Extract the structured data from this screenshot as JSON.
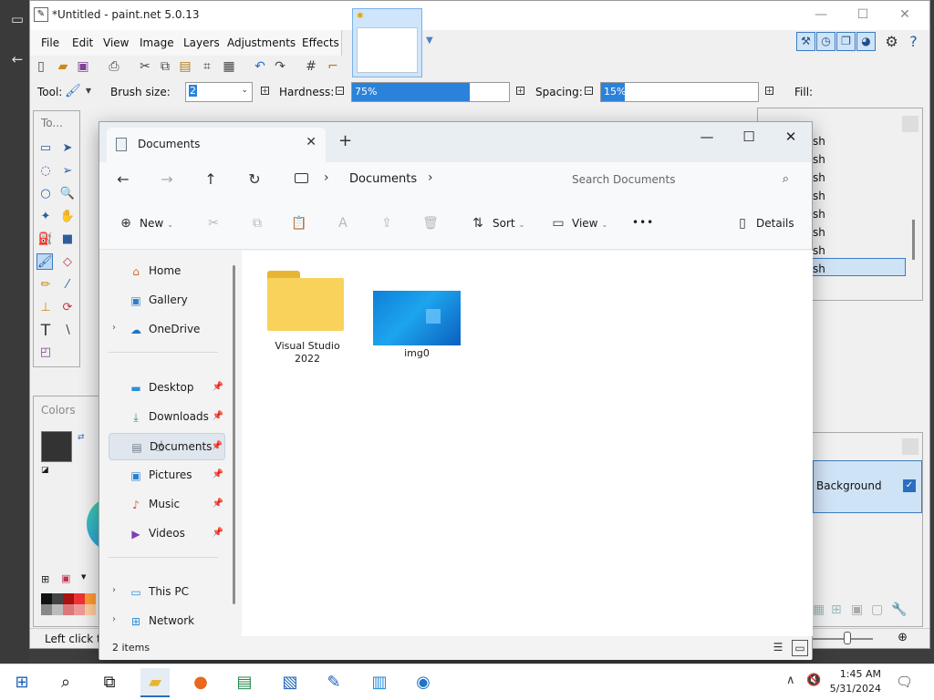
{
  "paintnet": {
    "title": "*Untitled - paint.net 5.0.13",
    "menu": [
      "File",
      "Edit",
      "View",
      "Image",
      "Layers",
      "Adjustments",
      "Effects"
    ],
    "options": {
      "tool_label": "Tool:",
      "brush_size_label": "Brush size:",
      "brush_size_value": "2",
      "hardness_label": "Hardness:",
      "hardness_value": "75%",
      "hardness_percent": 75,
      "spacing_label": "Spacing:",
      "spacing_value": "15%",
      "spacing_percent": 15,
      "fill_label": "Fill:"
    },
    "tools_panel_title": "To...",
    "colors_panel_title": "Colors",
    "history_items": [
      "sh",
      "sh",
      "sh",
      "sh",
      "sh",
      "sh",
      "sh",
      "sh"
    ],
    "layer_name": "Background",
    "status_text": "Left click to"
  },
  "explorer": {
    "tab_title": "Documents",
    "address_location": "Documents",
    "search_placeholder": "Search Documents",
    "commands": {
      "new": "New",
      "sort": "Sort",
      "view": "View",
      "more": "•••",
      "details": "Details"
    },
    "nav_top": [
      {
        "label": "Home",
        "icon": "home-icon"
      },
      {
        "label": "Gallery",
        "icon": "gallery-icon"
      },
      {
        "label": "OneDrive",
        "icon": "cloud-icon"
      }
    ],
    "nav_quick": [
      {
        "label": "Desktop",
        "icon": "desktop-icon"
      },
      {
        "label": "Downloads",
        "icon": "download-icon"
      },
      {
        "label": "Documents",
        "icon": "documents-icon"
      },
      {
        "label": "Pictures",
        "icon": "pictures-icon"
      },
      {
        "label": "Music",
        "icon": "music-icon"
      },
      {
        "label": "Videos",
        "icon": "videos-icon"
      }
    ],
    "nav_bottom": [
      {
        "label": "This PC",
        "icon": "pc-icon"
      },
      {
        "label": "Network",
        "icon": "network-icon"
      }
    ],
    "items": [
      {
        "name_line1": "Visual Studio",
        "name_line2": "2022",
        "type": "folder"
      },
      {
        "name_line1": "img0",
        "name_line2": "",
        "type": "image"
      }
    ],
    "status": "2 items"
  },
  "taskbar": {
    "time": "1:45 AM",
    "date": "5/31/2024"
  },
  "colors": {
    "accent": "#2a82da",
    "folder": "#f9d25c",
    "selected_nav": "#dfe6ee"
  }
}
